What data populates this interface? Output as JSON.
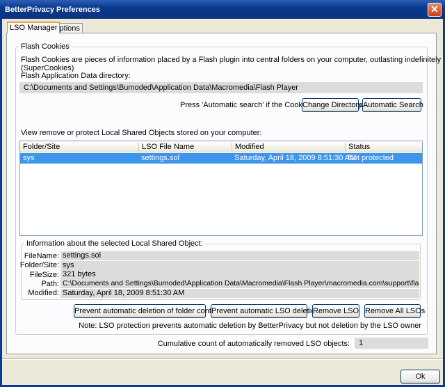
{
  "window": {
    "title": "BetterPrivacy Preferences"
  },
  "tabs": [
    {
      "label": "LSO Manager",
      "active": true
    },
    {
      "label": "Options",
      "active": false
    }
  ],
  "flash_cookies": {
    "legend": "Flash Cookies",
    "description": "Flash Cookies are pieces of information placed by a Flash plugin into central folders on your computer, outlasting indefinitely (SuperCookies)",
    "dir_label": "Flash Application Data directory:",
    "dir_value": "C:\\Documents and Settings\\Bumoded\\Application Data\\Macromedia\\Flash Player",
    "hint": "Press 'Automatic search' if the Cookie folder is unknown.",
    "change_directory": "Change Directory",
    "automatic_search": "Automatic Search",
    "list_label": "View remove or protect Local Shared Objects stored on your computer:"
  },
  "list": {
    "columns": [
      "Folder/Site",
      "LSO File Name",
      "Modified",
      "Status"
    ],
    "rows": [
      [
        "sys",
        "settings.sol",
        "Saturday, April 18, 2009 8:51:30 AM",
        "Not protected"
      ]
    ]
  },
  "info": {
    "legend": "Information about the selected Local Shared Object:",
    "fields": [
      {
        "label": "FileName:",
        "value": "settings.sol"
      },
      {
        "label": "Folder/Site:",
        "value": "sys"
      },
      {
        "label": "FileSize:",
        "value": "321 bytes"
      },
      {
        "label": "Path:",
        "value": "C:\\Documents and Settings\\Bumoded\\Application Data\\Macromedia\\Flash Player\\macromedia.com\\support\\flashplayer\\sys"
      },
      {
        "label": "Modified:",
        "value": "Saturday, April 18, 2009 8:51:30 AM"
      }
    ]
  },
  "actions": {
    "prevent_folder": "Prevent automatic deletion of folder contents",
    "prevent_lso": "Prevent automatic LSO deletion",
    "remove_lso": "Remove LSO",
    "remove_all": "Remove All LSOs",
    "note": "Note: LSO protection prevents automatic deletion by BetterPrivacy but not deletion by the LSO owner"
  },
  "cumulative": {
    "label": "Cumulative count of automatically removed LSO objects:",
    "value": "1"
  },
  "footer": {
    "ok": "Ok"
  }
}
